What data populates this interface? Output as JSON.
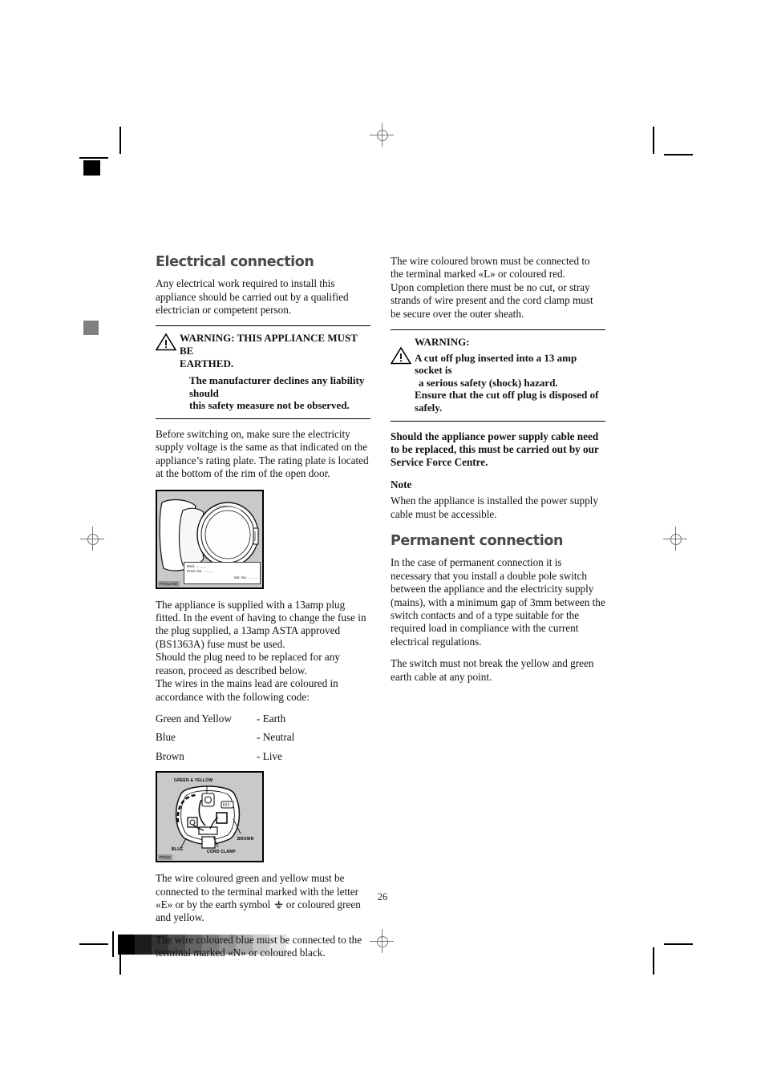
{
  "document": {
    "page_number": "26"
  },
  "left_column": {
    "heading": "Electrical connection",
    "intro": "Any electrical work required to install this appliance should be carried out by a qualified electrician or competent person.",
    "warning": {
      "icon": "warning-triangle-icon",
      "line1": "WARNING: THIS APPLIANCE MUST BE",
      "line2": "EARTHED.",
      "line3": "The manufacturer declines any liability should",
      "line4": "this safety measure not be observed."
    },
    "before_switching": "Before switching on, make sure the electricity supply voltage is the same as that indicated on the appliance’s rating plate. The rating plate is located at the bottom of the rim of the open door.",
    "door_figure": {
      "name": "rating-plate-door-diagram",
      "code": "P0042 BD",
      "plate_mod": "Mod. ..........",
      "plate_prod": "Prod. No. ..........",
      "plate_ser": "Ser. No. ........."
    },
    "plug_paragraph": "The appliance is supplied with a 13amp plug fitted. In the event of having to change the fuse in the plug supplied, a 13amp ASTA approved (BS1363A) fuse must be used.",
    "replace_paragraph": "Should the plug need to be replaced for any reason, proceed as described below.",
    "wires_intro": "The wires in the mains lead are coloured in accordance with the following code:",
    "wire_codes": [
      {
        "name": "Green and Yellow",
        "value": "- Earth"
      },
      {
        "name": "Blue",
        "value": "- Neutral"
      },
      {
        "name": "Brown",
        "value": "- Live"
      }
    ],
    "plug_figure": {
      "name": "plug-wiring-diagram",
      "code": "P0041",
      "labels": {
        "green_yellow": "GREEN & YELLOW",
        "brown": "BROWN",
        "blue": "BLUE",
        "cord_clamp": "CORD CLAMP"
      }
    },
    "green_yellow_text_a": "The wire coloured green and yellow must be connected to the terminal marked with the letter «E» or by the earth symbol",
    "green_yellow_text_b": "or coloured green and yellow.",
    "blue_text": "The wire coloured blue must be connected to the terminal marked «N» or coloured black."
  },
  "right_column": {
    "brown_text": "The wire coloured brown must be connected to the terminal marked «L» or coloured red.",
    "completion_text": "Upon completion there must be no cut, or stray strands of wire present and the cord clamp must be secure over the outer sheath.",
    "warning": {
      "icon": "warning-triangle-icon",
      "head": "WARNING:",
      "line1": "A cut off plug inserted into a 13 amp socket  is",
      "line2": "a serious safety (shock) hazard.",
      "line3": "Ensure that the cut off plug is disposed of",
      "line4": "safely."
    },
    "service_force": "Should the appliance power supply cable need to be replaced, this must be carried out by our Service Force Centre.",
    "note_heading": "Note",
    "note_text": "When the appliance is installed the power supply cable must be accessible.",
    "permanent_heading": "Permanent connection",
    "permanent_text": "In the case of permanent connection it is necessary that you install a double pole switch between the appliance and the electricity supply (mains), with a minimum gap of 3mm between the switch contacts and of a type suitable for the required load in compliance with the current electrical regulations.",
    "switch_text": "The switch must not break the yellow and green earth cable at any point."
  },
  "prepress": {
    "grey_strip": [
      "#000000",
      "#1c1c1c",
      "#333333",
      "#4b4b4b",
      "#636363",
      "#7b7b7b",
      "#949494",
      "#adadad",
      "#c8c8c8",
      "#e6e6e6"
    ],
    "black_square_color": "#000000",
    "grey_square_color": "#808080"
  }
}
